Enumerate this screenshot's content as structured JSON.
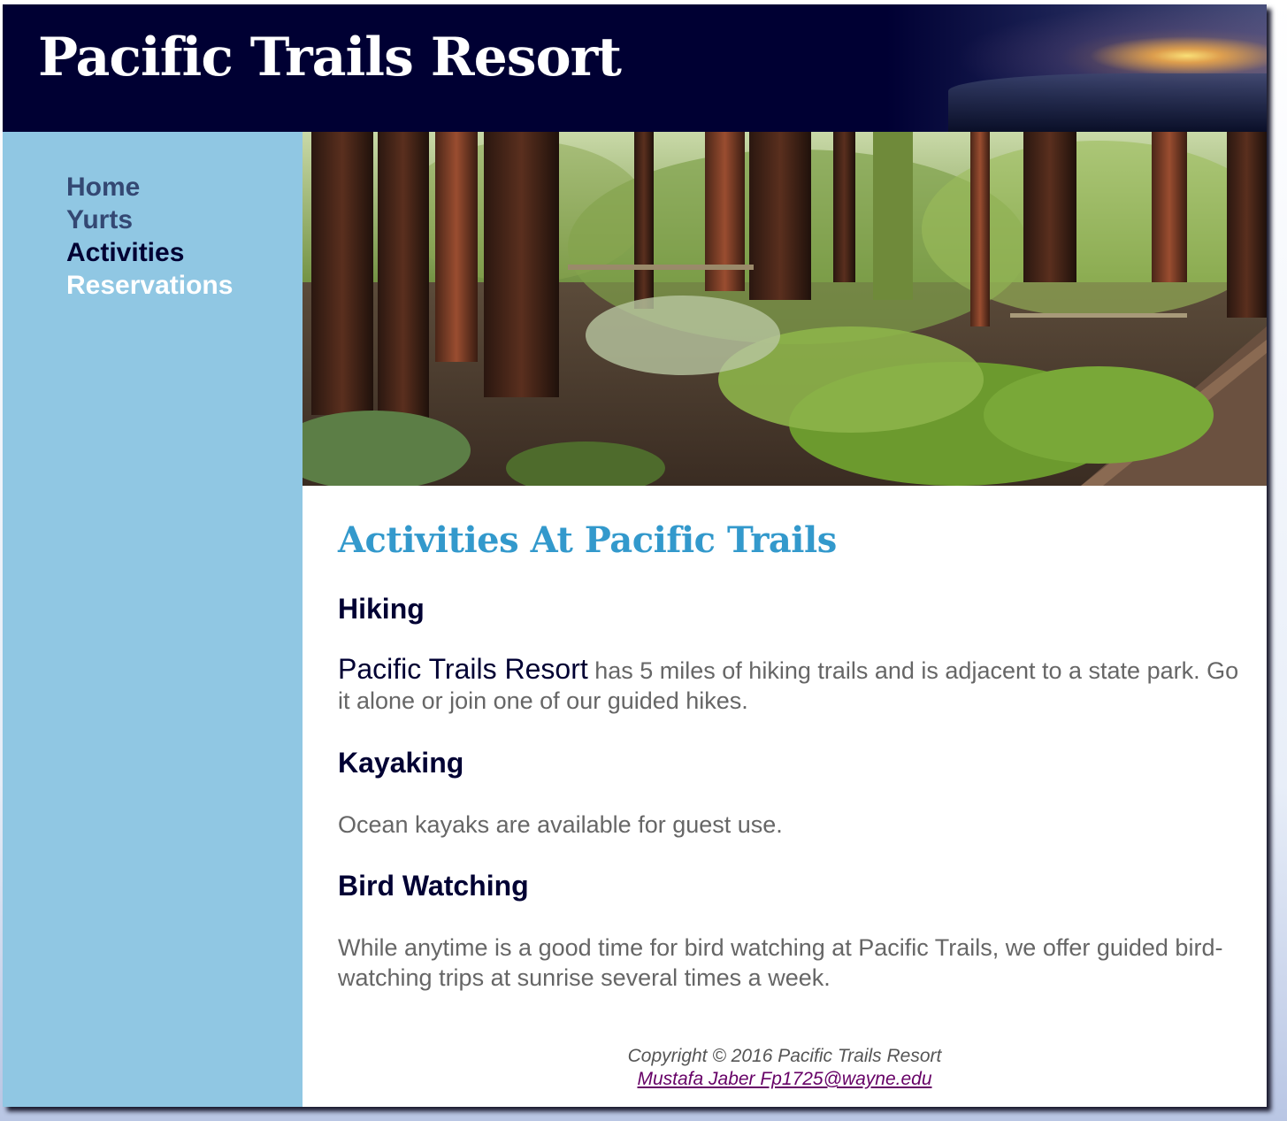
{
  "header": {
    "brand": "Pacific Trails Resort"
  },
  "nav": {
    "items": [
      {
        "label": "Home"
      },
      {
        "label": "Yurts"
      },
      {
        "label": "Activities"
      },
      {
        "label": "Reservations"
      }
    ]
  },
  "main": {
    "title": "Activities At Pacific Trails",
    "sections": [
      {
        "heading": "Hiking",
        "lead": "Pacific Trails Resort",
        "text": " has 5 miles of hiking trails and is adjacent to a state park. Go it alone or join one of our guided hikes."
      },
      {
        "heading": "Kayaking",
        "text": "Ocean kayaks are available for guest use."
      },
      {
        "heading": "Bird Watching",
        "text": "While anytime is a good time for bird watching at Pacific Trails, we offer guided bird-watching trips at sunrise several times a week."
      }
    ]
  },
  "footer": {
    "copyright": "Copyright © 2016 Pacific Trails Resort",
    "contact": "Mustafa Jaber Fp1725@wayne.edu"
  },
  "colors": {
    "header_bg": "#000033",
    "nav_bg": "#90c7e3",
    "title_blue": "#3399cc",
    "heading_navy": "#000033",
    "body_gray": "#666666",
    "link_purple": "#660066"
  }
}
